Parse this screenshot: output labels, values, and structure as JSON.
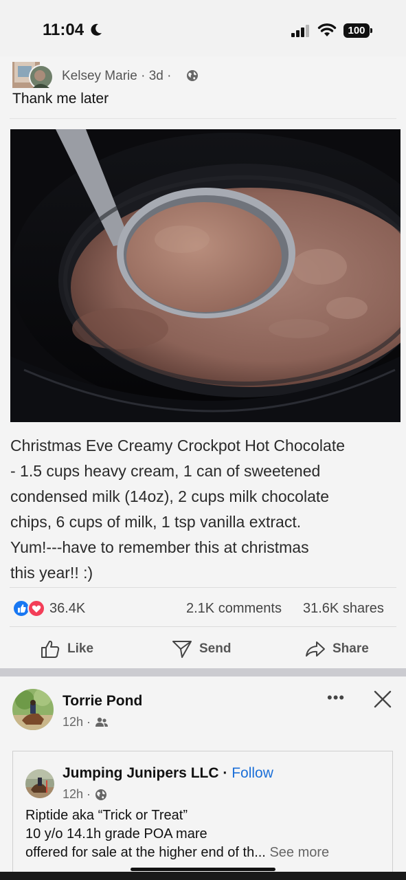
{
  "status_bar": {
    "time": "11:04",
    "battery": "100"
  },
  "post1": {
    "author": "Kelsey Marie",
    "meta": "· 3d ·",
    "caption": "Thank me later",
    "recipe_lines": [
      "Christmas Eve Creamy Crockpot Hot Chocolate",
      "- 1.5 cups heavy cream, 1 can of sweetened",
      "condensed milk (14oz), 2 cups milk chocolate",
      "chips, 6 cups of milk, 1 tsp vanilla extract.",
      "Yum!---have to remember this at christmas",
      "this year!! :)"
    ],
    "reactions": "36.4K",
    "comments": "2.1K comments",
    "shares": "31.6K shares",
    "actions": {
      "like": "Like",
      "send": "Send",
      "share": "Share"
    }
  },
  "post2": {
    "author": "Torrie Pond",
    "meta": "12h ·",
    "more": "•••",
    "shared": {
      "author": "Jumping Junipers LLC",
      "separator": " · ",
      "follow": "Follow",
      "meta": "12h ·",
      "lines": [
        "Riptide aka “Trick or Treat”",
        "10 y/o 14.1h grade POA mare",
        "offered for sale at the higher end of th..."
      ],
      "see_more": "See more"
    }
  },
  "colors": {
    "accent": "#1b6fd8",
    "like_blue": "#1877f2",
    "love_red": "#f33e58"
  },
  "icons": [
    "moon-icon",
    "cellular-signal-icon",
    "wifi-icon",
    "globe-icon",
    "thumbs-up-icon",
    "send-icon",
    "share-icon",
    "friends-icon",
    "more-icon",
    "close-icon"
  ]
}
